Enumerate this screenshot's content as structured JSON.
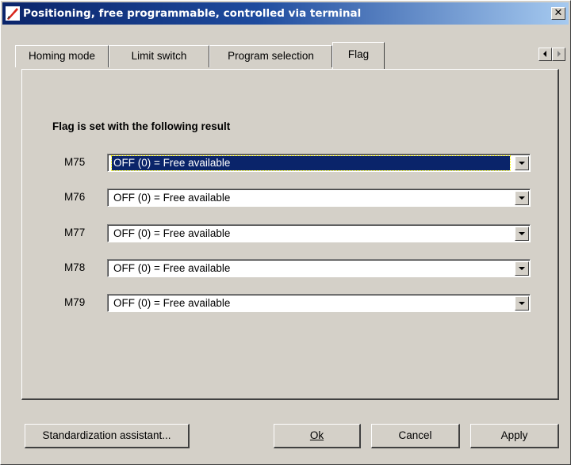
{
  "window": {
    "title": "Positioning, free programmable, controlled via terminal",
    "close_label": "✕"
  },
  "tabs": [
    {
      "label": "Homing mode",
      "active": false
    },
    {
      "label": "Limit switch",
      "active": false
    },
    {
      "label": "Program selection",
      "active": false
    },
    {
      "label": "Flag",
      "active": true
    }
  ],
  "panel": {
    "section_label": "Flag is set with the following result",
    "rows": [
      {
        "label": "M75",
        "value": "OFF (0) = Free available",
        "selected": true
      },
      {
        "label": "M76",
        "value": "OFF (0) = Free available",
        "selected": false
      },
      {
        "label": "M77",
        "value": "OFF (0) = Free available",
        "selected": false
      },
      {
        "label": "M78",
        "value": "OFF (0) = Free available",
        "selected": false
      },
      {
        "label": "M79",
        "value": "OFF (0) = Free available",
        "selected": false
      }
    ]
  },
  "buttons": {
    "assistant": "Standardization assistant...",
    "ok": "Ok",
    "cancel": "Cancel",
    "apply": "Apply"
  },
  "colors": {
    "window_bg": "#d4d0c8",
    "titlebar_start": "#0a246a",
    "titlebar_end": "#a6caf0",
    "selection": "#0a246a"
  }
}
